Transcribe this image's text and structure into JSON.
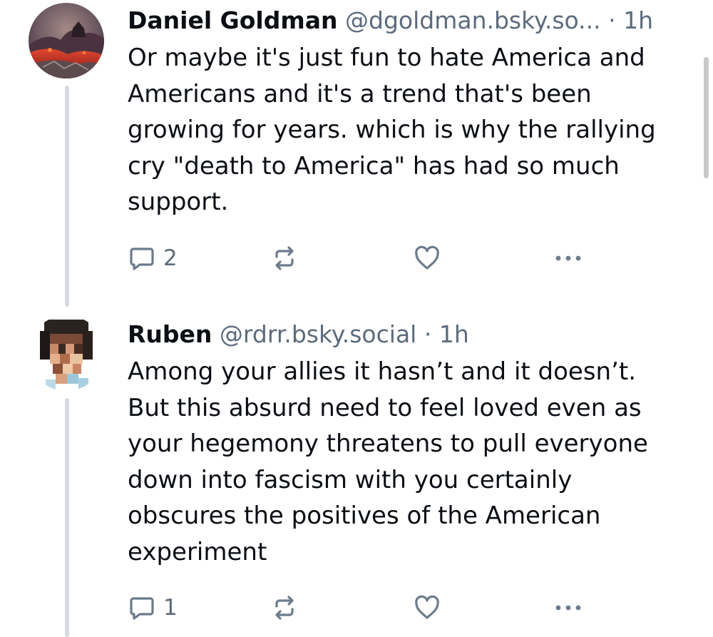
{
  "posts": [
    {
      "display_name": "Daniel Goldman",
      "handle": "@dgoldman.bsky.so...",
      "separator": "·",
      "time": "1h",
      "text": "Or maybe it's just fun to hate America and Americans and it's a trend that's been growing for years. which is why the rallying cry \"death to America\" has had so much support.",
      "reply_count": "2",
      "avatar_icon": "volcano-landscape-avatar"
    },
    {
      "display_name": "Ruben",
      "handle": "@rdrr.bsky.social",
      "separator": "·",
      "time": "1h",
      "text": "Among your allies it hasn’t and it doesn’t. But this absurd need to feel loved even as your hegemony threatens to pull everyone down into fascism with you certainly obscures the positives of the American experiment",
      "reply_count": "1",
      "avatar_icon": "pixelated-face-avatar"
    }
  ],
  "icons": {
    "reply": "reply-icon",
    "repost": "repost-icon",
    "like": "heart-icon",
    "more": "more-options-icon"
  },
  "colors": {
    "text": "#0b0f14",
    "muted": "#5b6b7c",
    "icon": "#6b7b8c",
    "thread_line": "#d4dbe2"
  }
}
